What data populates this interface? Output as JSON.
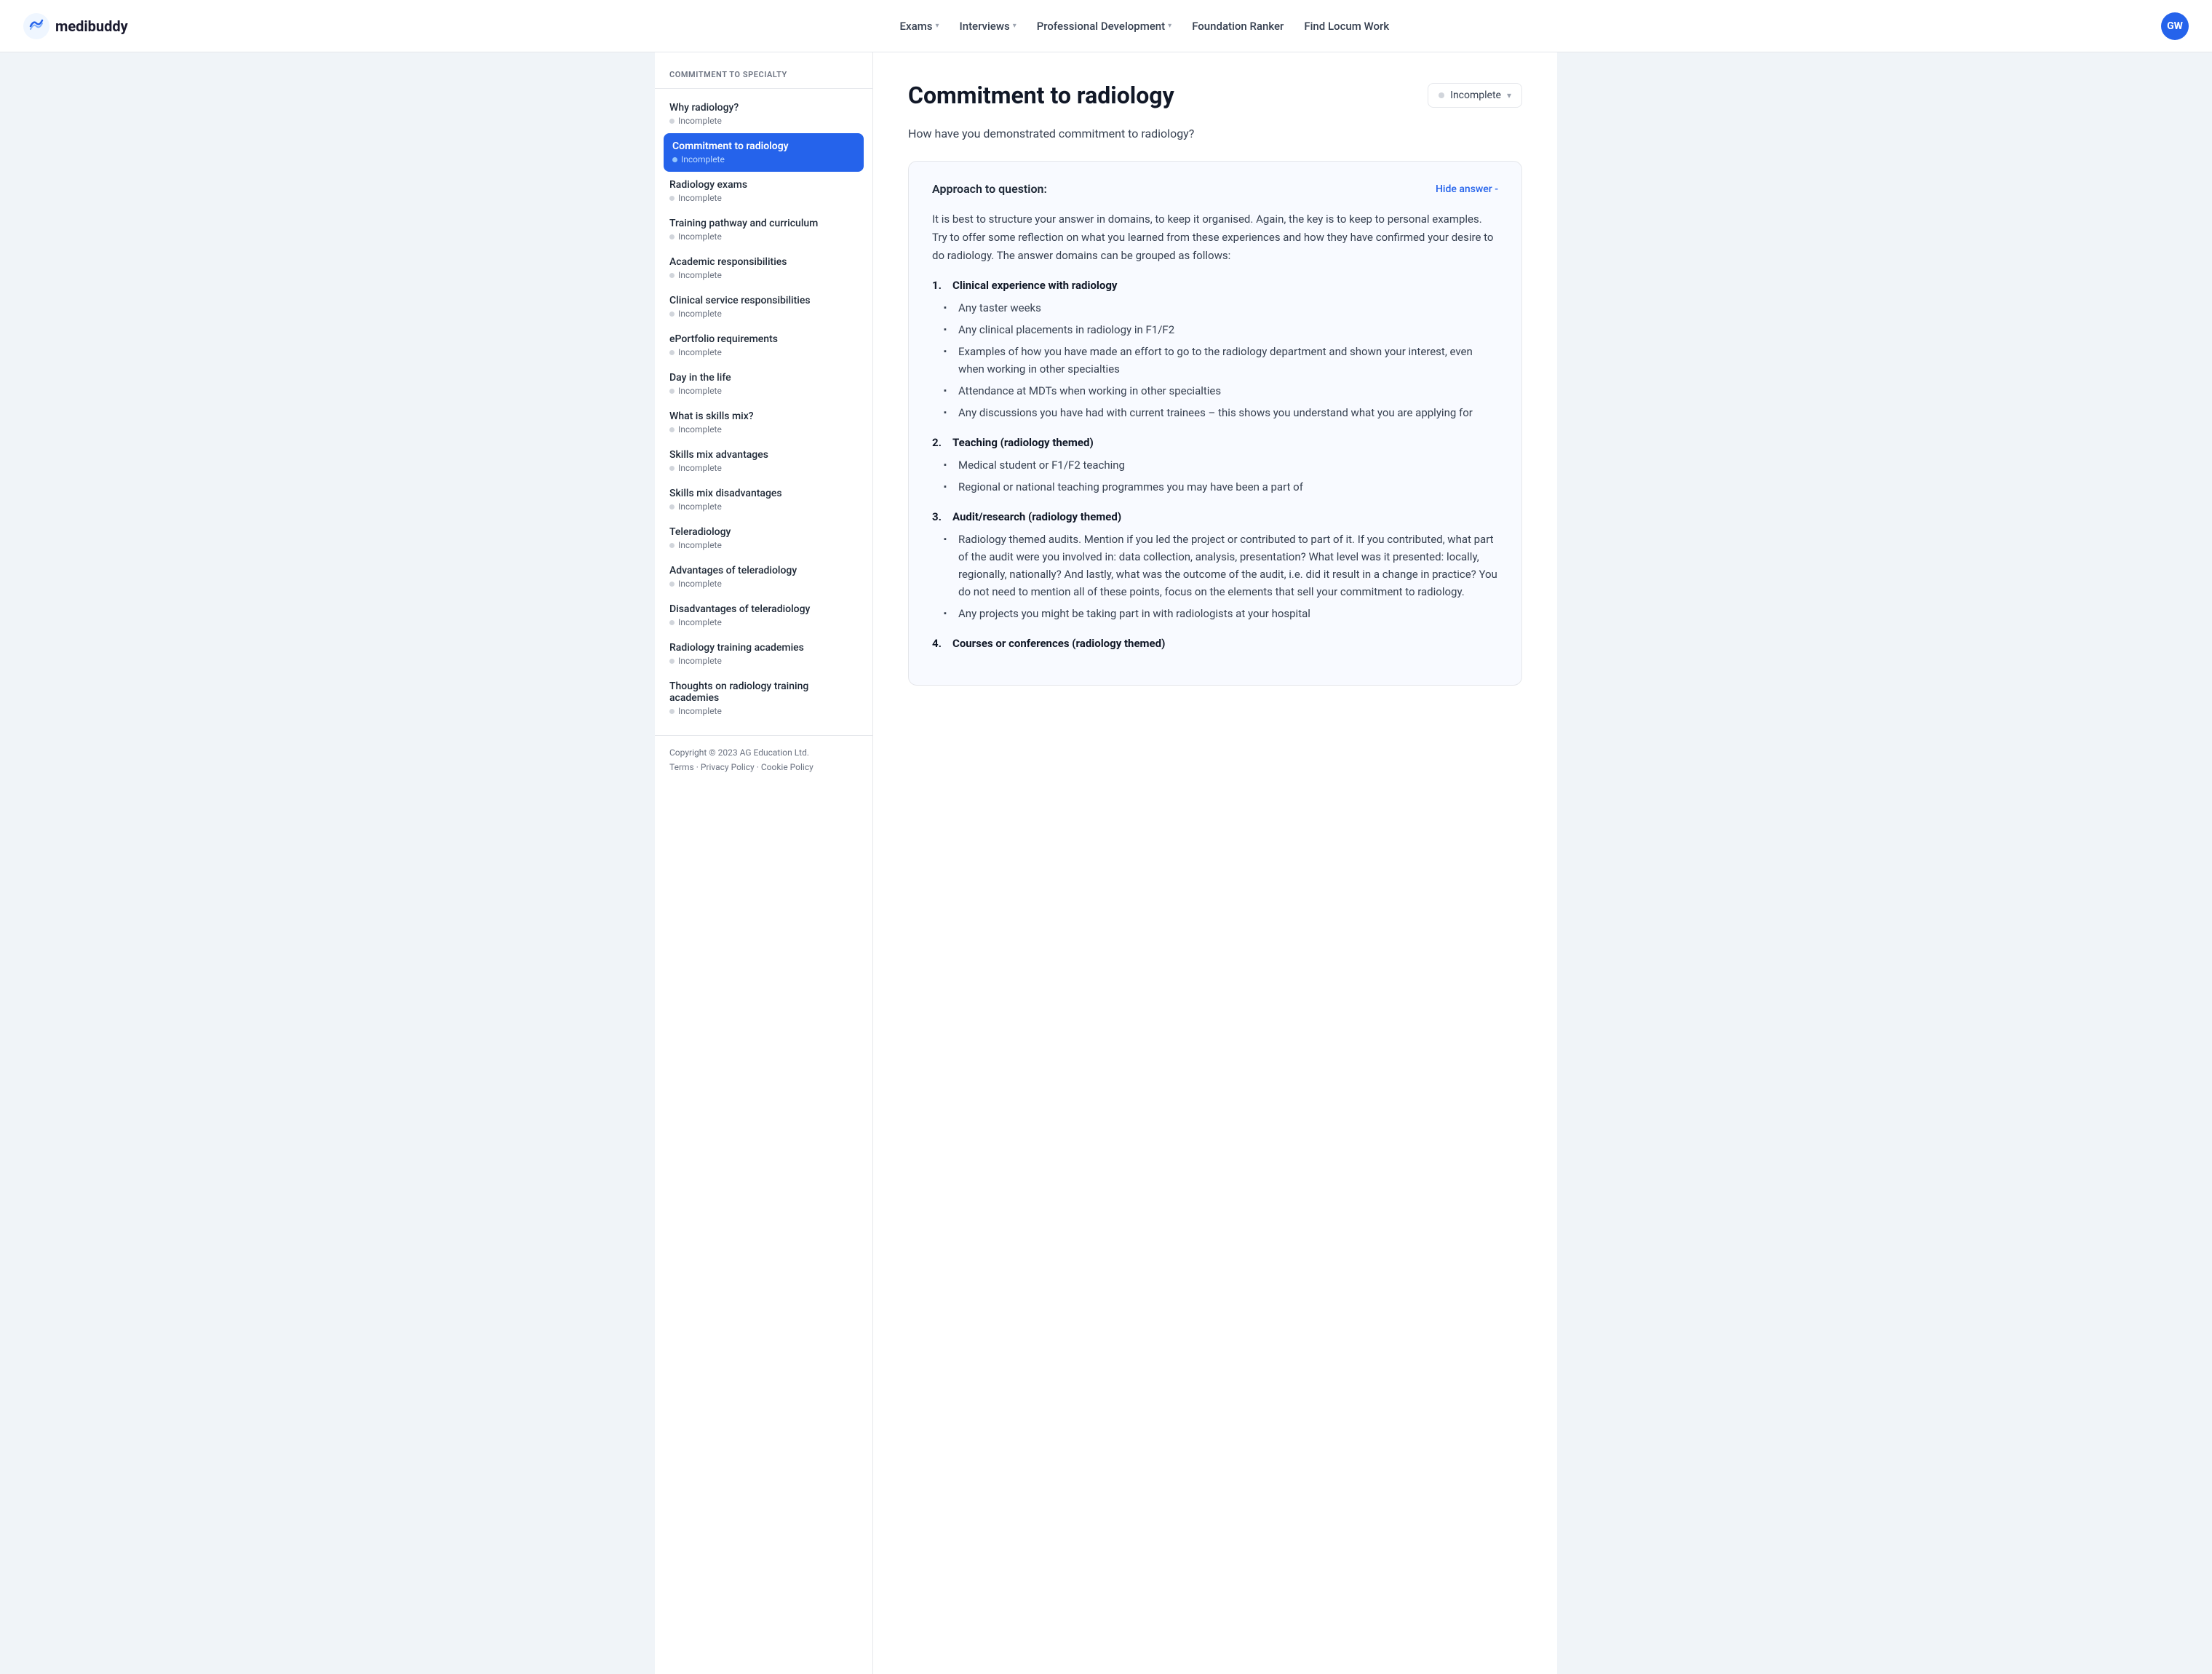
{
  "header": {
    "logo_text": "medibuddy",
    "nav_items": [
      {
        "label": "Exams",
        "has_dropdown": true
      },
      {
        "label": "Interviews",
        "has_dropdown": true
      },
      {
        "label": "Professional Development",
        "has_dropdown": true
      },
      {
        "label": "Foundation Ranker",
        "has_dropdown": false
      },
      {
        "label": "Find Locum Work",
        "has_dropdown": false
      }
    ],
    "avatar_initials": "GW"
  },
  "sidebar": {
    "section_title": "Commitment to Specialty",
    "items": [
      {
        "title": "Why radiology?",
        "status": "Incomplete",
        "active": false
      },
      {
        "title": "Commitment to radiology",
        "status": "Incomplete",
        "active": true
      },
      {
        "title": "Radiology exams",
        "status": "Incomplete",
        "active": false
      },
      {
        "title": "Training pathway and curriculum",
        "status": "Incomplete",
        "active": false
      },
      {
        "title": "Academic responsibilities",
        "status": "Incomplete",
        "active": false
      },
      {
        "title": "Clinical service responsibilities",
        "status": "Incomplete",
        "active": false
      },
      {
        "title": "ePortfolio requirements",
        "status": "Incomplete",
        "active": false
      },
      {
        "title": "Day in the life",
        "status": "Incomplete",
        "active": false
      },
      {
        "title": "What is skills mix?",
        "status": "Incomplete",
        "active": false
      },
      {
        "title": "Skills mix advantages",
        "status": "Incomplete",
        "active": false
      },
      {
        "title": "Skills mix disadvantages",
        "status": "Incomplete",
        "active": false
      },
      {
        "title": "Teleradiology",
        "status": "Incomplete",
        "active": false
      },
      {
        "title": "Advantages of teleradiology",
        "status": "Incomplete",
        "active": false
      },
      {
        "title": "Disadvantages of teleradiology",
        "status": "Incomplete",
        "active": false
      },
      {
        "title": "Radiology training academies",
        "status": "Incomplete",
        "active": false
      },
      {
        "title": "Thoughts on radiology training academies",
        "status": "Incomplete",
        "active": false
      }
    ]
  },
  "main": {
    "page_title": "Commitment to radiology",
    "status_label": "Incomplete",
    "question_text": "How have you demonstrated commitment to radiology?",
    "answer_box": {
      "approach_label": "Approach to question:",
      "hide_answer_label": "Hide answer -",
      "intro": "It is best to structure your answer in domains, to keep it organised. Again, the key is to keep to personal examples. Try to offer some reflection on what you learned from these experiences and how they have confirmed your desire to do radiology. The answer domains can be grouped as follows:",
      "sections": [
        {
          "number": "1.",
          "title": "Clinical experience with radiology",
          "bullets": [
            "Any taster weeks",
            "Any clinical placements in radiology in F1/F2",
            "Examples of how you have made an effort to go to the radiology department and shown your interest, even when working in other specialties",
            "Attendance at MDTs when working in other specialties",
            "Any discussions you have had with current trainees – this shows you understand what you are applying for"
          ]
        },
        {
          "number": "2.",
          "title": "Teaching (radiology themed)",
          "bullets": [
            "Medical student or F1/F2 teaching",
            "Regional or national teaching programmes you may have been a part of"
          ]
        },
        {
          "number": "3.",
          "title": "Audit/research (radiology themed)",
          "bullets": [
            "Radiology themed audits. Mention if you led the project or contributed to part of it. If you contributed, what part of the audit were you involved in: data collection, analysis, presentation? What level was it presented: locally, regionally, nationally? And lastly, what was the outcome of the audit, i.e. did it result in a change in practice? You do not need to mention all of these points, focus on the elements that sell your commitment to radiology.",
            "Any projects you might be taking part in with radiologists at your hospital"
          ]
        },
        {
          "number": "4.",
          "title": "Courses or conferences (radiology themed)",
          "bullets": []
        }
      ]
    }
  },
  "footer": {
    "copyright": "Copyright © 2023 AG Education Ltd.",
    "links": [
      "Terms",
      "Privacy Policy",
      "Cookie Policy"
    ]
  }
}
